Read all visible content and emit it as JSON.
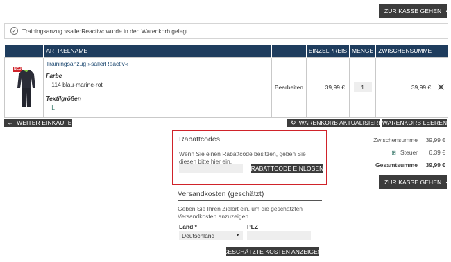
{
  "top_checkout": {
    "label": "ZUR KASSE GEHEN"
  },
  "notice": {
    "text": "Trainingsanzug »sallerReactiv« wurde in den Warenkorb gelegt."
  },
  "table": {
    "headers": [
      "ARTIKELNAME",
      "EINZELPREIS",
      "MENGE",
      "ZWISCHENSUMME"
    ],
    "row": {
      "badge": "NEU",
      "name": "Trainingsanzug »sallerReactiv«",
      "color_label": "Farbe",
      "color_value": "114 blau-marine-rot",
      "size_label": "Textilgrößen",
      "size_value": "L",
      "edit": "Bearbeiten",
      "unit_price": "39,99 €",
      "quantity": "1",
      "subtotal": "39,99 €"
    }
  },
  "actions": {
    "continue": "WEITER EINKAUFEN",
    "update": "WARENKORB AKTUALISIEREN",
    "empty": "WARENKORB LEEREN"
  },
  "coupon": {
    "title": "Rabattcodes",
    "text": "Wenn Sie einen Rabattcode besitzen, geben Sie diesen bitte hier ein.",
    "button": "RABATTCODE EINLÖSEN"
  },
  "shipping": {
    "title": "Versandkosten (geschätzt)",
    "text": "Geben Sie Ihren Zielort ein, um die geschätzten Versandkosten anzuzeigen.",
    "country_label": "Land *",
    "zip_label": "PLZ",
    "country_value": "Deutschland",
    "button": "GESCHÄTZTE KOSTEN ANZEIGEN"
  },
  "totals": {
    "subtotal_label": "Zwischensumme",
    "subtotal_value": "39,99 €",
    "tax_label": "Steuer",
    "tax_value": "6,39 €",
    "total_label": "Gesamtsumme",
    "total_value": "39,99 €",
    "checkout": "ZUR KASSE GEHEN"
  },
  "colors": {
    "header_bg": "#1f3d5e",
    "button_bg": "#3c3c3c",
    "highlight": "#d0232a"
  }
}
